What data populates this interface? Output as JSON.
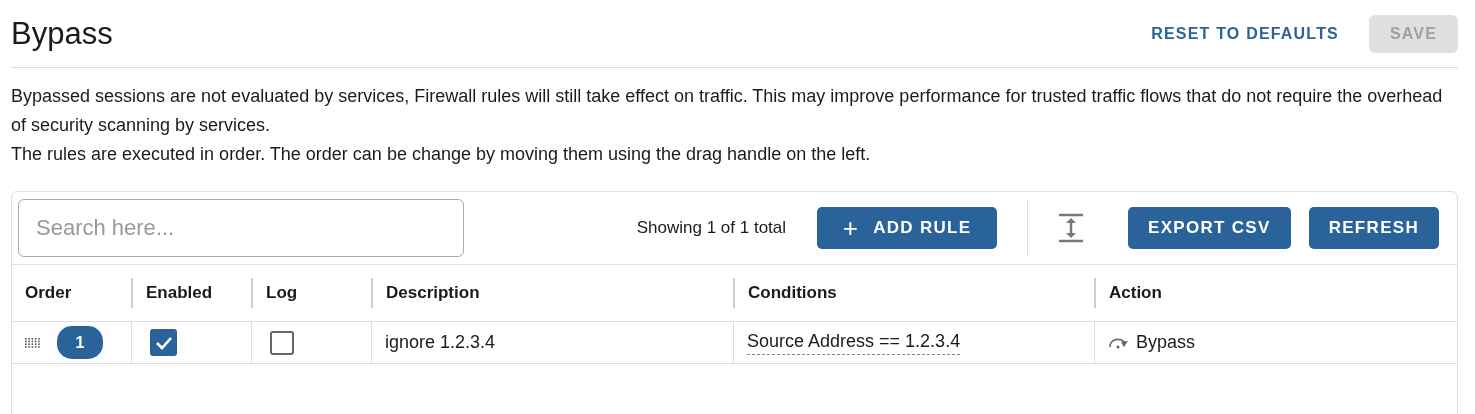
{
  "page": {
    "title": "Bypass"
  },
  "header_actions": [
    {
      "label": "RESET TO DEFAULTS",
      "kind": "text",
      "disabled": false
    },
    {
      "label": "SAVE",
      "kind": "filled",
      "disabled": true
    }
  ],
  "description": [
    "Bypassed sessions are not evaluated by services, Firewall rules will still take effect on traffic. This may improve performance for trusted traffic flows that do not require the overhead of security scanning by services.",
    "The rules are executed in order. The order can be change by moving them using the drag handle on the left."
  ],
  "toolbar": {
    "search": {
      "placeholder": "Search here..."
    },
    "count": "Showing 1 of 1 total",
    "add_button": {
      "label": "ADD RULE",
      "icon": "+"
    },
    "buttons": [
      "EXPORT CSV",
      "REFRESH"
    ]
  },
  "table": {
    "columns": [
      "Order",
      "Enabled",
      "Log",
      "Description",
      "Conditions",
      "Action"
    ],
    "rows": [
      {
        "order": "1",
        "enabled": true,
        "log": false,
        "description": "ignore 1.2.3.4",
        "conditions": "Source Address == 1.2.3.4",
        "action": "Bypass"
      }
    ]
  }
}
